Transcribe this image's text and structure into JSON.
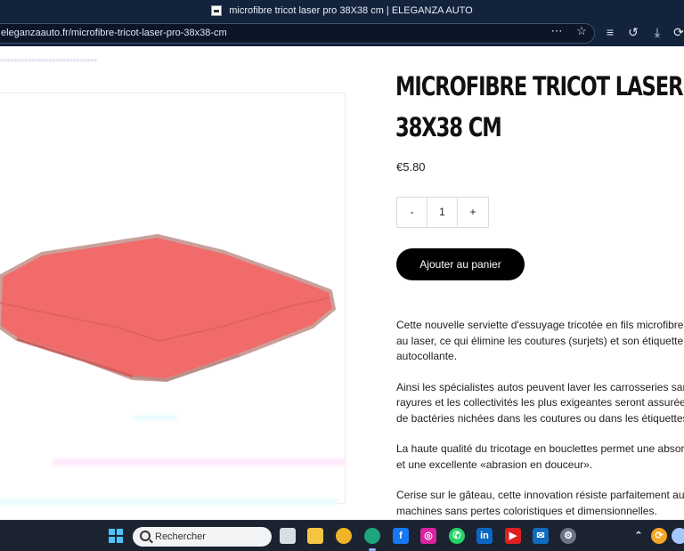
{
  "browser": {
    "window_title": "microfibre tricot laser pro 38X38 cm | ELEGANZA AUTO",
    "url": "eleganzaauto.fr/microfibre-tricot-laser-pro-38x38-cm",
    "icons": [
      "page-favicon-icon",
      "more-options-icon",
      "favorite-star-icon",
      "favorites-list-icon",
      "history-icon",
      "downloads-icon",
      "profile-icon"
    ]
  },
  "product": {
    "title_line1": "MICROFIBRE TRICOT LASER PRO",
    "title_line2": "38X38 CM",
    "price": "€5.80",
    "quantity": {
      "minus": "-",
      "value": "1",
      "plus": "+"
    },
    "add_to_cart": "Ajouter au panier",
    "image_alt": "pink microfibre towel",
    "image_colors": {
      "towel": "#f16b6b",
      "edge": "#c9a09a"
    },
    "description": [
      "Cette nouvelle serviette d'essuyage tricotée en fils microfibres e",
      "au laser, ce qui élimine les coutures (surjets) et son étiquette inf",
      "autocollante.",
      "Ainsi les spécialistes autos peuvent laver les carrosseries sans r",
      "rayures et les collectivités les plus exigeantes seront assurées d",
      "de bactéries nichées dans les coutures ou dans les étiquettes.",
      "La haute qualité du tricotage en bouclettes permet une absorpti",
      "et une excellente «abrasion en douceur».",
      "Cerise sur le gâteau, cette innovation résiste parfaitement aux la",
      "machines sans pertes coloristiques et dimensionnelles."
    ]
  },
  "taskbar": {
    "search_placeholder": "Rechercher",
    "apps": [
      "windows-start-icon",
      "task-view-icon",
      "file-explorer-icon",
      "chrome-icon",
      "edge-icon",
      "facebook-icon",
      "instagram-icon",
      "whatsapp-icon",
      "linkedin-icon",
      "youtube-icon",
      "outlook-icon",
      "settings-icon"
    ],
    "tray": [
      "chevron-up-icon",
      "security-icon",
      "weather-icon"
    ]
  },
  "colors": {
    "chrome_bg": "#14233c",
    "button_bg": "#000000",
    "taskbar_bg": "#1b2230"
  }
}
